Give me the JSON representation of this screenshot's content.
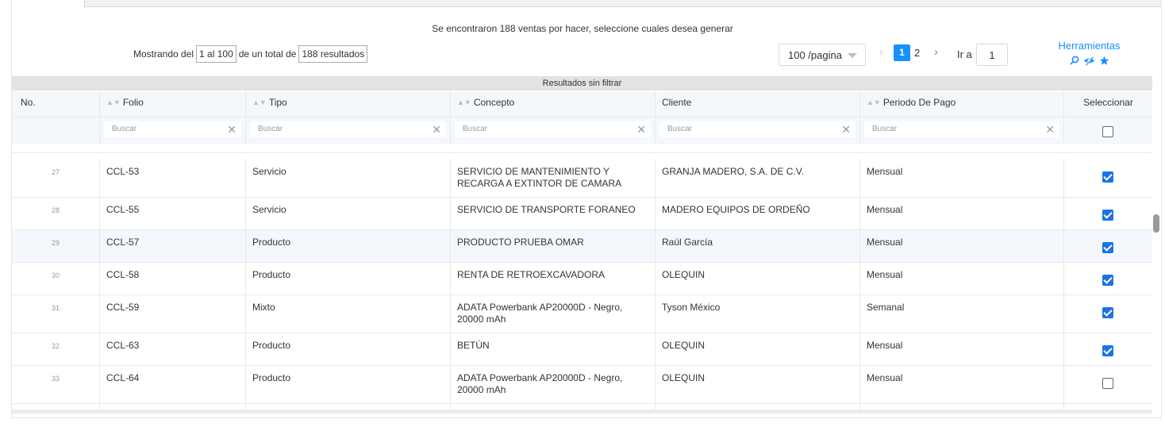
{
  "header": {
    "found_message": "Se encontraron 188 ventas por hacer, seleccione cuales desea generar",
    "showing_prefix": "Mostrando del",
    "range_value": "1 al 100",
    "total_prefix": "de un total de",
    "total_value": "188 resultados"
  },
  "pagination": {
    "page_size": "100 /pagina",
    "prev_symbol": "‹",
    "current_page": "1",
    "other_page": "2",
    "next_symbol": "›",
    "goto_label": "Ir a",
    "goto_value": "1"
  },
  "tools": {
    "label": "Herramientas",
    "icons": [
      "search-icon",
      "hide-icon",
      "star-icon"
    ]
  },
  "colors": {
    "accent": "#1890ff",
    "checkbox_checked": "#1a73e8",
    "header_bg": "#f4f8fd",
    "banner_bg": "#e3e3e3"
  },
  "table": {
    "banner": "Resultados sin filtrar",
    "columns": {
      "no": "No.",
      "folio": "Folio",
      "tipo": "Tipo",
      "concepto": "Concepto",
      "cliente": "Cliente",
      "periodo": "Periodo De Pago",
      "seleccionar": "Seleccionar"
    },
    "filter_placeholder": "Buscar",
    "filter_clear_symbol": "✕",
    "select_all_checked": false,
    "rows": [
      {
        "no": "27",
        "folio": "CCL-53",
        "tipo": "Servicio",
        "concepto": "SERVICIO DE MANTENIMIENTO Y RECARGA A EXTINTOR DE CAMARA",
        "cliente": "GRANJA MADERO, S.A. DE C.V.",
        "periodo": "Mensual",
        "checked": true
      },
      {
        "no": "28",
        "folio": "CCL-55",
        "tipo": "Servicio",
        "concepto": "SERVICIO DE TRANSPORTE FORANEO",
        "cliente": "MADERO EQUIPOS DE ORDEÑO",
        "periodo": "Mensual",
        "checked": true
      },
      {
        "no": "29",
        "folio": "CCL-57",
        "tipo": "Producto",
        "concepto": "PRODUCTO PRUEBA OMAR",
        "cliente": "Raúl García",
        "periodo": "Mensual",
        "checked": true
      },
      {
        "no": "30",
        "folio": "CCL-58",
        "tipo": "Producto",
        "concepto": "RENTA DE RETROEXCAVADORA",
        "cliente": "OLEQUIN",
        "periodo": "Mensual",
        "checked": true
      },
      {
        "no": "31",
        "folio": "CCL-59",
        "tipo": "Mixto",
        "concepto": "ADATA Powerbank AP20000D - Negro, 20000 mAh",
        "cliente": "Tyson México",
        "periodo": "Semanal",
        "checked": true
      },
      {
        "no": "32",
        "folio": "CCL-63",
        "tipo": "Producto",
        "concepto": "BETÚN",
        "cliente": "OLEQUIN",
        "periodo": "Mensual",
        "checked": true
      },
      {
        "no": "33",
        "folio": "CCL-64",
        "tipo": "Producto",
        "concepto": "ADATA Powerbank AP20000D - Negro, 20000 mAh",
        "cliente": "OLEQUIN",
        "periodo": "Mensual",
        "checked": false
      }
    ]
  }
}
